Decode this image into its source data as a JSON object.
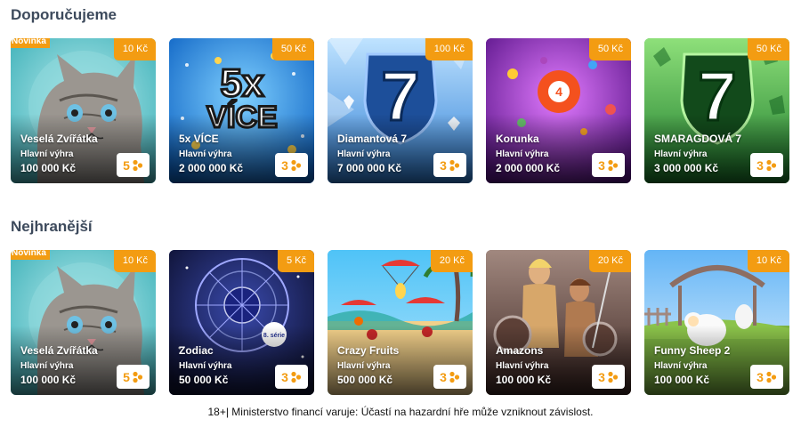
{
  "sections": [
    {
      "title": "Doporučujeme",
      "cards": [
        {
          "name": "Veselá Zvířátka",
          "price": "10 Kč",
          "badge": "Novinka",
          "prize_label": "Hlavní výhra",
          "prize": "100 000 Kč",
          "odds": "5",
          "art": "cat",
          "accent": "#7fd3d6"
        },
        {
          "name": "5x VÍCE",
          "price": "50 Kč",
          "badge": "",
          "prize_label": "Hlavní výhra",
          "prize": "2 000 000 Kč",
          "odds": "3",
          "art": "5x",
          "art_text_1": "5x",
          "art_text_2": "VÍCE",
          "accent": "#1e88e5"
        },
        {
          "name": "Diamantová 7",
          "price": "100 Kč",
          "badge": "",
          "prize_label": "Hlavní výhra",
          "prize": "7 000 000 Kč",
          "odds": "3",
          "art": "diamond7",
          "art_text_1": "7",
          "accent": "#3f8fd8"
        },
        {
          "name": "Korunka",
          "price": "50 Kč",
          "badge": "",
          "prize_label": "Hlavní výhra",
          "prize": "2 000 000 Kč",
          "odds": "3",
          "art": "korunka",
          "art_text_1": "4",
          "accent": "#8e24aa"
        },
        {
          "name": "SMARAGDOVÁ 7",
          "price": "50 Kč",
          "badge": "",
          "prize_label": "Hlavní výhra",
          "prize": "3 000 000 Kč",
          "odds": "3",
          "art": "emerald7",
          "art_text_1": "7",
          "accent": "#2e9e3c"
        }
      ]
    },
    {
      "title": "Nejhranější",
      "cards": [
        {
          "name": "Veselá Zvířátka",
          "price": "10 Kč",
          "badge": "Novinka",
          "prize_label": "Hlavní výhra",
          "prize": "100 000 Kč",
          "odds": "5",
          "art": "cat",
          "accent": "#7fd3d6"
        },
        {
          "name": "Zodiac",
          "price": "5 Kč",
          "badge": "",
          "prize_label": "Hlavní výhra",
          "prize": "50 000 Kč",
          "odds": "3",
          "art": "zodiac",
          "art_text_1": "8. série",
          "accent": "#283593"
        },
        {
          "name": "Crazy Fruits",
          "price": "20 Kč",
          "badge": "",
          "prize_label": "Hlavní výhra",
          "prize": "500 000 Kč",
          "odds": "3",
          "art": "fruits",
          "accent": "#29b6f6"
        },
        {
          "name": "Amazons",
          "price": "20 Kč",
          "badge": "",
          "prize_label": "Hlavní výhra",
          "prize": "100 000 Kč",
          "odds": "3",
          "art": "amazons",
          "accent": "#8d6e63"
        },
        {
          "name": "Funny Sheep 2",
          "price": "10 Kč",
          "badge": "",
          "prize_label": "Hlavní výhra",
          "prize": "100 000 Kč",
          "odds": "3",
          "art": "sheep",
          "accent": "#64b5f6"
        }
      ]
    }
  ],
  "footer": "18+| Ministerstvo financí varuje: Účastí na hazardní hře může vzniknout závislost.",
  "colors": {
    "badge": "#f39c12",
    "title": "#3d4a5c"
  }
}
